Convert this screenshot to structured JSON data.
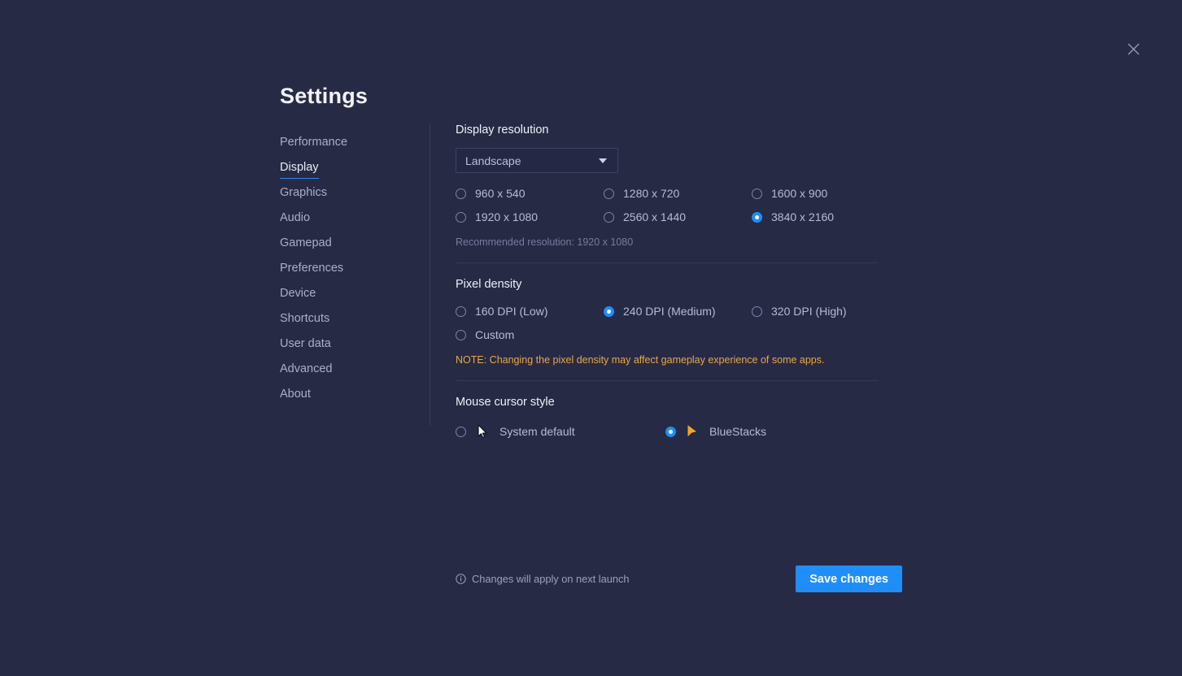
{
  "window": {
    "title": "Settings",
    "close_icon": "close-icon"
  },
  "sidebar": {
    "items": [
      {
        "label": "Performance",
        "active": false
      },
      {
        "label": "Display",
        "active": true
      },
      {
        "label": "Graphics",
        "active": false
      },
      {
        "label": "Audio",
        "active": false
      },
      {
        "label": "Gamepad",
        "active": false
      },
      {
        "label": "Preferences",
        "active": false
      },
      {
        "label": "Device",
        "active": false
      },
      {
        "label": "Shortcuts",
        "active": false
      },
      {
        "label": "User data",
        "active": false
      },
      {
        "label": "Advanced",
        "active": false
      },
      {
        "label": "About",
        "active": false
      }
    ]
  },
  "display_resolution": {
    "title": "Display resolution",
    "orientation_select": {
      "value": "Landscape",
      "caret_icon": "chevron-down-icon"
    },
    "options": [
      {
        "label": "960 x 540",
        "selected": false
      },
      {
        "label": "1280 x 720",
        "selected": false
      },
      {
        "label": "1600 x 900",
        "selected": false
      },
      {
        "label": "1920 x 1080",
        "selected": false
      },
      {
        "label": "2560 x 1440",
        "selected": false
      },
      {
        "label": "3840 x 2160",
        "selected": true
      }
    ],
    "recommended": "Recommended resolution: 1920 x 1080"
  },
  "pixel_density": {
    "title": "Pixel density",
    "options": [
      {
        "label": "160 DPI (Low)",
        "selected": false
      },
      {
        "label": "240 DPI (Medium)",
        "selected": true
      },
      {
        "label": "320 DPI (High)",
        "selected": false
      },
      {
        "label": "Custom",
        "selected": false
      }
    ],
    "note": "NOTE: Changing the pixel density may affect gameplay experience of some apps."
  },
  "mouse_cursor_style": {
    "title": "Mouse cursor style",
    "options": [
      {
        "label": "System default",
        "selected": false,
        "icon": "cursor-arrow-system-icon"
      },
      {
        "label": "BlueStacks",
        "selected": true,
        "icon": "cursor-arrow-bluestacks-icon"
      }
    ]
  },
  "footer": {
    "info_icon": "info-icon",
    "note": "Changes will apply on next launch",
    "save_label": "Save changes"
  },
  "colors": {
    "background": "#272a45",
    "accent_blue": "#1f8efa",
    "note_orange": "#e9a83e",
    "cursor_orange": "#f5a623",
    "text_primary": "#eef0f7",
    "text_secondary": "#b6bbd4",
    "text_muted": "#767c9d",
    "divider": "#343956"
  }
}
